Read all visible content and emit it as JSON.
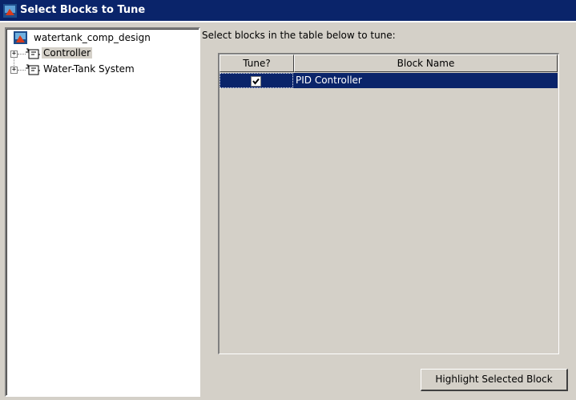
{
  "window": {
    "title": "Select Blocks to Tune",
    "icon": "matlab-model-icon"
  },
  "tree": {
    "root": {
      "label": "watertank_comp_design",
      "icon": "simulink-model-icon"
    },
    "nodes": [
      {
        "label": "Controller",
        "icon": "subsystem-block-icon",
        "expander": "+",
        "selected": true
      },
      {
        "label": "Water-Tank System",
        "icon": "subsystem-block-icon",
        "expander": "+",
        "selected": false
      }
    ]
  },
  "instructions": "Select blocks in the table below to tune:",
  "table": {
    "columns": [
      "Tune?",
      "Block Name"
    ],
    "rows": [
      {
        "tune": true,
        "block_name": "PID Controller",
        "selected": true
      }
    ]
  },
  "buttons": {
    "highlight_label": "Highlight Selected Block"
  },
  "colors": {
    "titlebar": "#0a246a",
    "selection": "#0a246a",
    "face": "#d4d0c8"
  }
}
